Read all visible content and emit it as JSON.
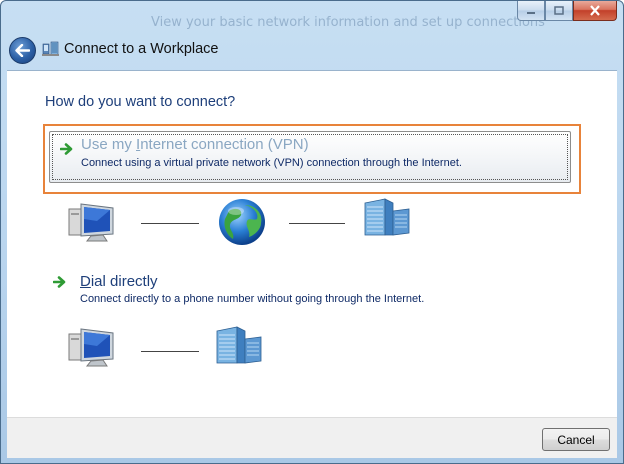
{
  "window": {
    "title_background_text": "View your basic network information and set up connections"
  },
  "nav": {
    "title": "Connect to a Workplace"
  },
  "main": {
    "heading": "How do you want to connect?",
    "options": [
      {
        "title_pre": "Use my ",
        "title_mnemonic": "I",
        "title_post": "nternet connection (VPN)",
        "description": "Connect using a virtual private network (VPN) connection through the Internet."
      },
      {
        "title_pre": "",
        "title_mnemonic": "D",
        "title_post": "ial directly",
        "description": "Connect directly to a phone number without going through the Internet."
      }
    ]
  },
  "footer": {
    "cancel_label": "Cancel"
  },
  "icons": {
    "back": "back-arrow-icon",
    "wizard": "workplace-network-icon",
    "option_arrow": "green-arrow-icon",
    "computer": "computer-monitor-icon",
    "globe": "internet-globe-icon",
    "building": "office-building-icon"
  },
  "colors": {
    "focus_outline": "#e8833a",
    "heading": "#1e3f7a",
    "vpn_title": "#8aa7c2"
  }
}
